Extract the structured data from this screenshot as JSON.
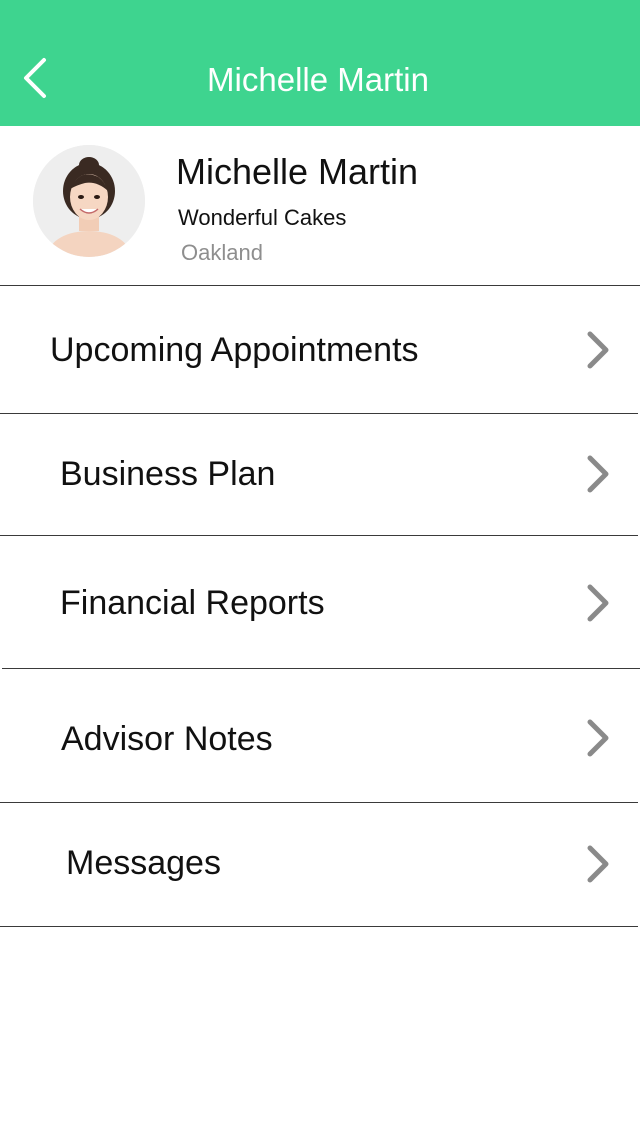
{
  "header": {
    "title": "Michelle Martin",
    "back_icon": "chevron-left-icon",
    "color": "#3ed48f"
  },
  "profile": {
    "name": "Michelle Martin",
    "business": "Wonderful Cakes",
    "city": "Oakland",
    "avatar_icon": "person-avatar"
  },
  "menu": {
    "items": [
      {
        "label": "Upcoming Appointments",
        "icon": "chevron-right-icon"
      },
      {
        "label": "Business Plan",
        "icon": "chevron-right-icon"
      },
      {
        "label": "Financial Reports",
        "icon": "chevron-right-icon"
      },
      {
        "label": "Advisor Notes",
        "icon": "chevron-right-icon"
      },
      {
        "label": "Messages",
        "icon": "chevron-right-icon"
      }
    ]
  }
}
